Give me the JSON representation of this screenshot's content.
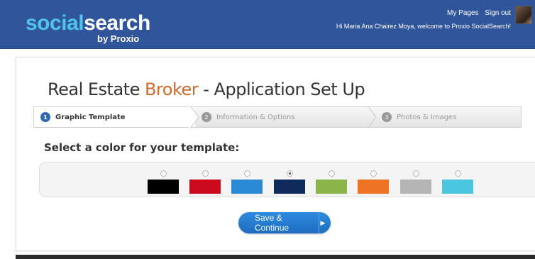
{
  "header": {
    "logo_part1": "social",
    "logo_part2": "search",
    "byline": "by Proxio",
    "nav": {
      "my_pages": "My Pages",
      "sign_out": "Sign out"
    },
    "welcome": "Hi Maria Ana Chairez Moya, welcome to Proxio SocialSearch!"
  },
  "page": {
    "title_part1": "Real Estate ",
    "title_highlight": "Broker",
    "title_part2": " - Application Set Up"
  },
  "steps": [
    {
      "number": "1",
      "label": "Graphic Template",
      "active": true
    },
    {
      "number": "2",
      "label": "Information & Options",
      "active": false
    },
    {
      "number": "3",
      "label": "Photos & Images",
      "active": false
    }
  ],
  "color_section": {
    "label": "Select a color for your template:",
    "selected": "navy",
    "options": [
      {
        "name": "black",
        "color": "#000000"
      },
      {
        "name": "red",
        "color": "#cc0a1e"
      },
      {
        "name": "blue",
        "color": "#2a8ad6"
      },
      {
        "name": "navy",
        "color": "#0e2b5c"
      },
      {
        "name": "green",
        "color": "#8bb54a"
      },
      {
        "name": "orange",
        "color": "#ec7424"
      },
      {
        "name": "gray",
        "color": "#b5b5b5"
      },
      {
        "name": "cyan",
        "color": "#4bc6e0"
      }
    ]
  },
  "actions": {
    "save_label": "Save & Continue"
  }
}
